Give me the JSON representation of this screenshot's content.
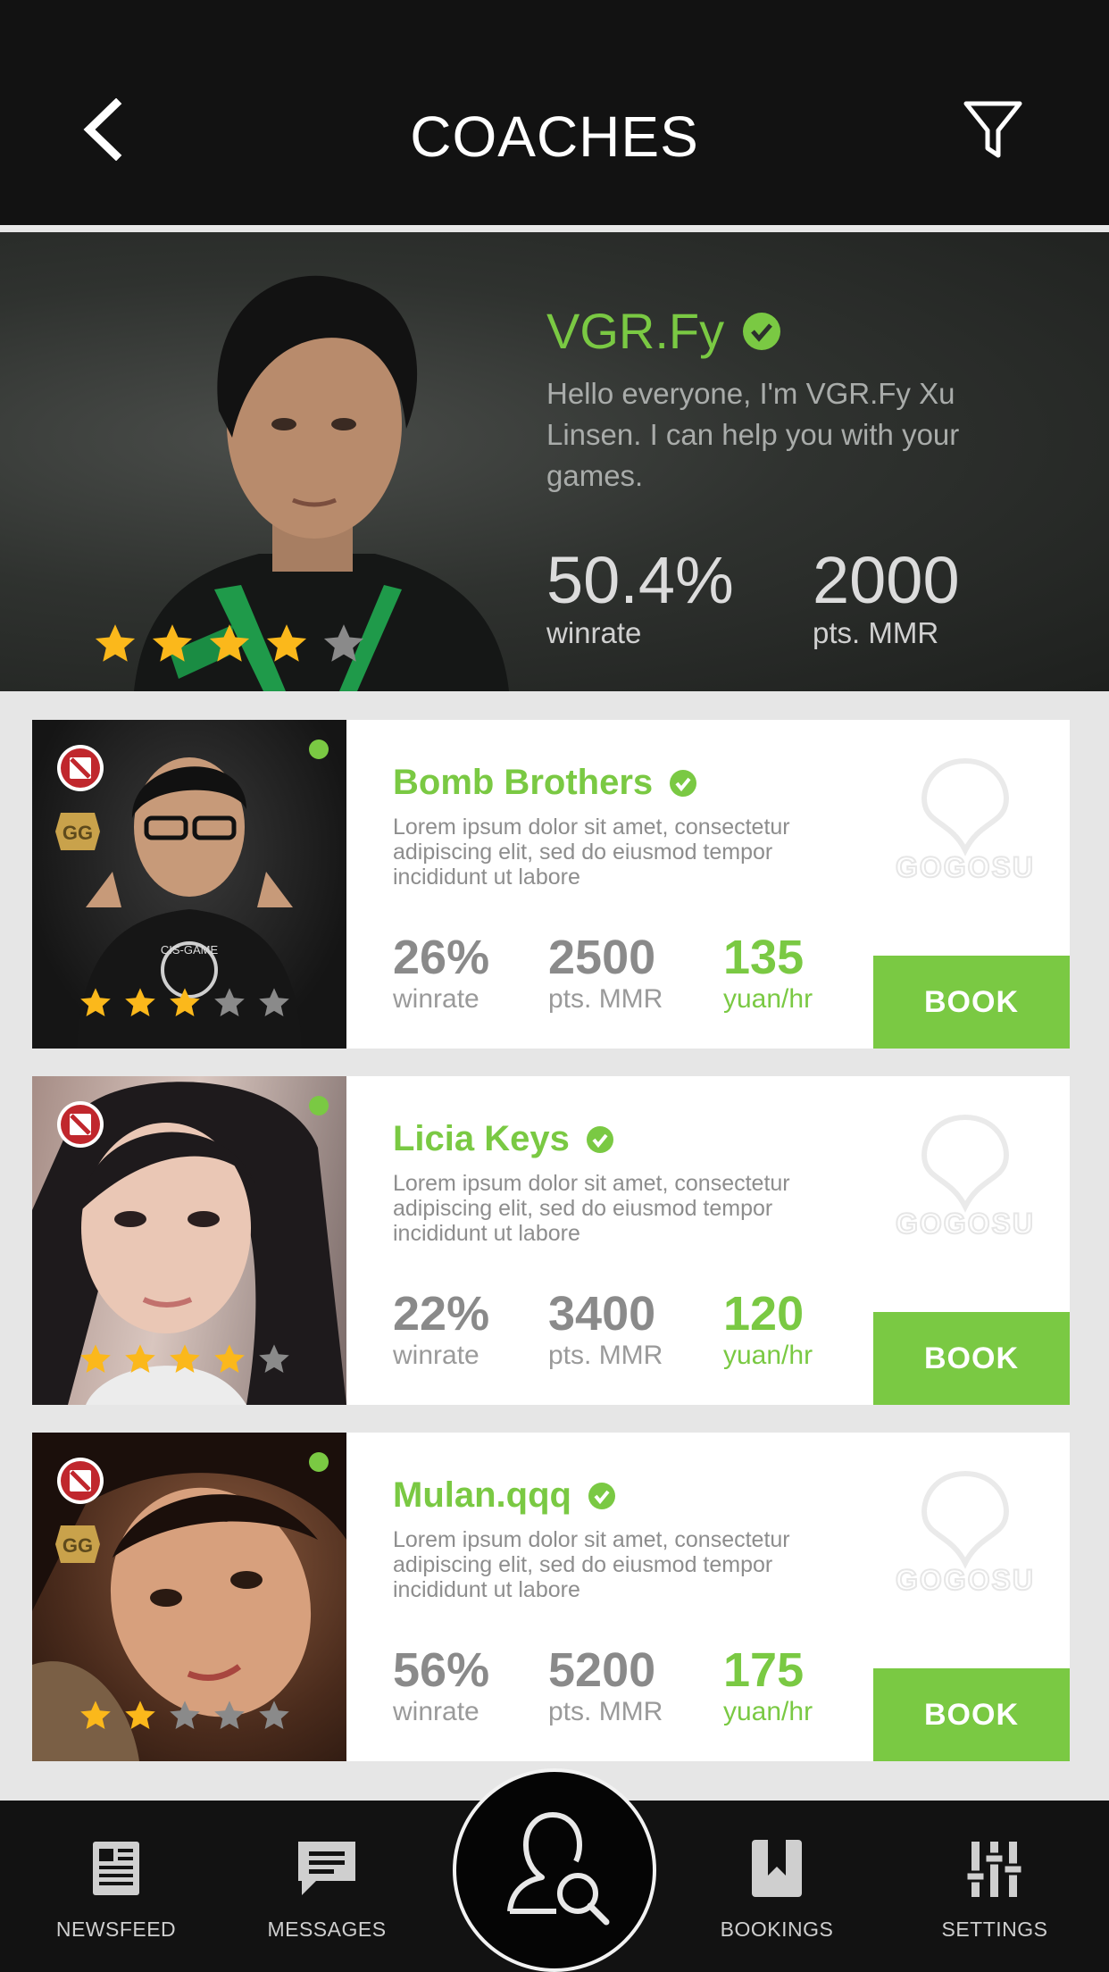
{
  "header": {
    "title": "COACHES",
    "back_icon": "chevron-left-icon",
    "filter_icon": "filter-icon"
  },
  "featured": {
    "name": "VGR.Fy",
    "verified_icon": "verified-check-icon",
    "bio": "Hello everyone, I'm VGR.Fy Xu Linsen. I can help you with your games.",
    "rating": 4,
    "winrate_value": "50.4%",
    "winrate_label": "winrate",
    "mmr_value": "2000",
    "mmr_label": "pts. MMR"
  },
  "coaches": [
    {
      "name": "Bomb Brothers",
      "description": "Lorem ipsum dolor sit amet, consectetur adipiscing elit, sed do eiusmod tempor incididunt ut labore",
      "rating": 3,
      "online": true,
      "shirt_text": "CIS-GAME",
      "winrate_value": "26%",
      "winrate_label": "winrate",
      "mmr_value": "2500",
      "mmr_label": "pts. MMR",
      "price_value": "135",
      "price_label": "yuan/hr",
      "book_label": "BOOK",
      "logo_text": "GOGOSU"
    },
    {
      "name": "Licia Keys",
      "description": "Lorem ipsum dolor sit amet, consectetur adipiscing elit, sed do eiusmod tempor incididunt ut labore",
      "rating": 4,
      "online": true,
      "winrate_value": "22%",
      "winrate_label": "winrate",
      "mmr_value": "3400",
      "mmr_label": "pts. MMR",
      "price_value": "120",
      "price_label": "yuan/hr",
      "book_label": "BOOK",
      "logo_text": "GOGOSU"
    },
    {
      "name": "Mulan.qqq",
      "description": "Lorem ipsum dolor sit amet, consectetur adipiscing elit, sed do eiusmod tempor incididunt ut labore",
      "rating": 2,
      "online": true,
      "winrate_value": "56%",
      "winrate_label": "winrate",
      "mmr_value": "5200",
      "mmr_label": "pts. MMR",
      "price_value": "175",
      "price_label": "yuan/hr",
      "book_label": "BOOK",
      "logo_text": "GOGOSU"
    }
  ],
  "bottom_nav": {
    "items": [
      {
        "label": "NEWSFEED",
        "icon": "newspaper-icon"
      },
      {
        "label": "MESSAGES",
        "icon": "chat-bubble-icon"
      },
      {
        "label": "BOOKINGS",
        "icon": "bookmark-icon"
      },
      {
        "label": "SETTINGS",
        "icon": "sliders-icon"
      }
    ],
    "center_icon": "find-coach-icon"
  },
  "colors": {
    "accent": "#7ac943",
    "header_bg": "#121212",
    "star_filled": "#fbb81b",
    "star_empty": "#8a8a8a"
  }
}
